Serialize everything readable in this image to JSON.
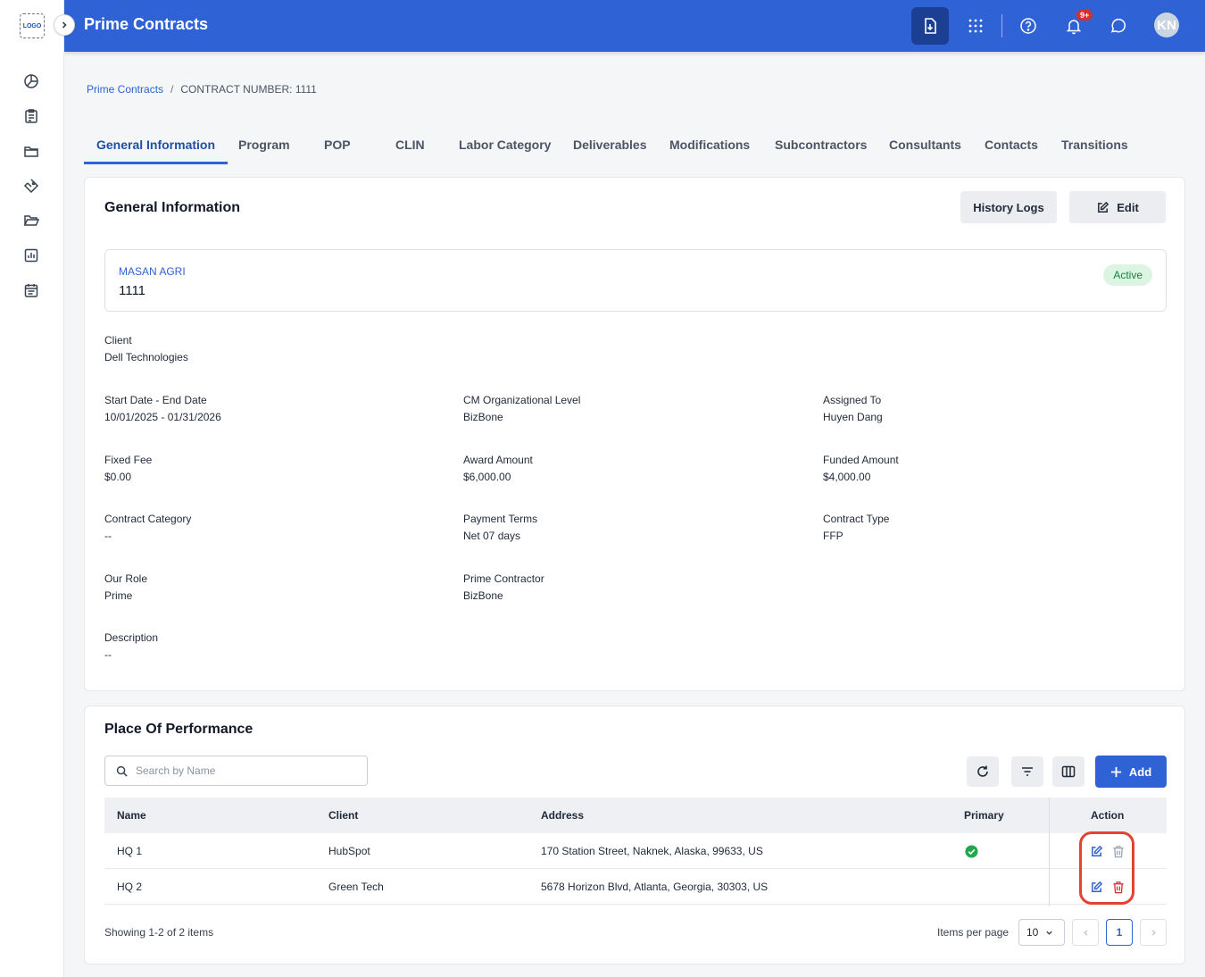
{
  "sidebar": {
    "logo": "LOGO",
    "items": [
      {
        "icon": "pie-chart-icon"
      },
      {
        "icon": "clipboard-list-icon"
      },
      {
        "icon": "folder-icon"
      },
      {
        "icon": "tag-icon"
      },
      {
        "icon": "folder-open-icon"
      },
      {
        "icon": "bar-chart-icon"
      },
      {
        "icon": "calendar-list-icon"
      }
    ]
  },
  "header": {
    "title": "Prime Contracts",
    "notification_count": "9+",
    "avatar_initials": "KN"
  },
  "breadcrumb": {
    "root": "Prime Contracts",
    "separator": "/",
    "current": "CONTRACT NUMBER: 1111"
  },
  "tabs": [
    {
      "label": "General Information"
    },
    {
      "label": "Program"
    },
    {
      "label": "POP"
    },
    {
      "label": "CLIN"
    },
    {
      "label": "Labor Category"
    },
    {
      "label": "Deliverables"
    },
    {
      "label": "Modifications"
    },
    {
      "label": "Subcontractors"
    },
    {
      "label": "Consultants"
    },
    {
      "label": "Contacts"
    },
    {
      "label": "Transitions"
    }
  ],
  "general": {
    "title": "General Information",
    "history_label": "History Logs",
    "edit_label": "Edit",
    "org": "MASAN AGRI",
    "number": "1111",
    "status": "Active",
    "status_color": "#16813b",
    "fields": {
      "client": {
        "label": "Client",
        "value": "Dell Technologies"
      },
      "dates": {
        "label": "Start Date - End Date",
        "value": "10/01/2025 - 01/31/2026"
      },
      "cm_level": {
        "label": "CM Organizational Level",
        "value": "BizBone"
      },
      "assigned": {
        "label": "Assigned To",
        "value": "Huyen Dang"
      },
      "fixed_fee": {
        "label": "Fixed Fee",
        "value": "$0.00"
      },
      "award": {
        "label": "Award Amount",
        "value": "$6,000.00"
      },
      "funded": {
        "label": "Funded Amount",
        "value": "$4,000.00"
      },
      "category": {
        "label": "Contract Category",
        "value": "--"
      },
      "payment": {
        "label": "Payment Terms",
        "value": "Net 07 days"
      },
      "type": {
        "label": "Contract Type",
        "value": "FFP"
      },
      "role": {
        "label": "Our Role",
        "value": "Prime"
      },
      "prime": {
        "label": "Prime Contractor",
        "value": "BizBone"
      },
      "description": {
        "label": "Description",
        "value": "--"
      }
    }
  },
  "pop": {
    "title": "Place Of Performance",
    "search_placeholder": "Search by Name",
    "add_label": "Add",
    "columns": {
      "name": "Name",
      "client": "Client",
      "address": "Address",
      "primary": "Primary",
      "action": "Action"
    },
    "rows": [
      {
        "name": "HQ 1",
        "client": "HubSpot",
        "address": "170 Station Street, Naknek, Alaska, 99633, US",
        "primary": true
      },
      {
        "name": "HQ 2",
        "client": "Green Tech",
        "address": "5678 Horizon Blvd, Atlanta, Georgia, 30303, US",
        "primary": false
      }
    ],
    "showing": "Showing 1-2 of 2 items",
    "items_per_page_label": "Items per page",
    "items_per_page": "10",
    "current_page": "1"
  },
  "colors": {
    "brand": "#2f62d4",
    "danger": "#d62f2f",
    "success": "#22a84a"
  }
}
